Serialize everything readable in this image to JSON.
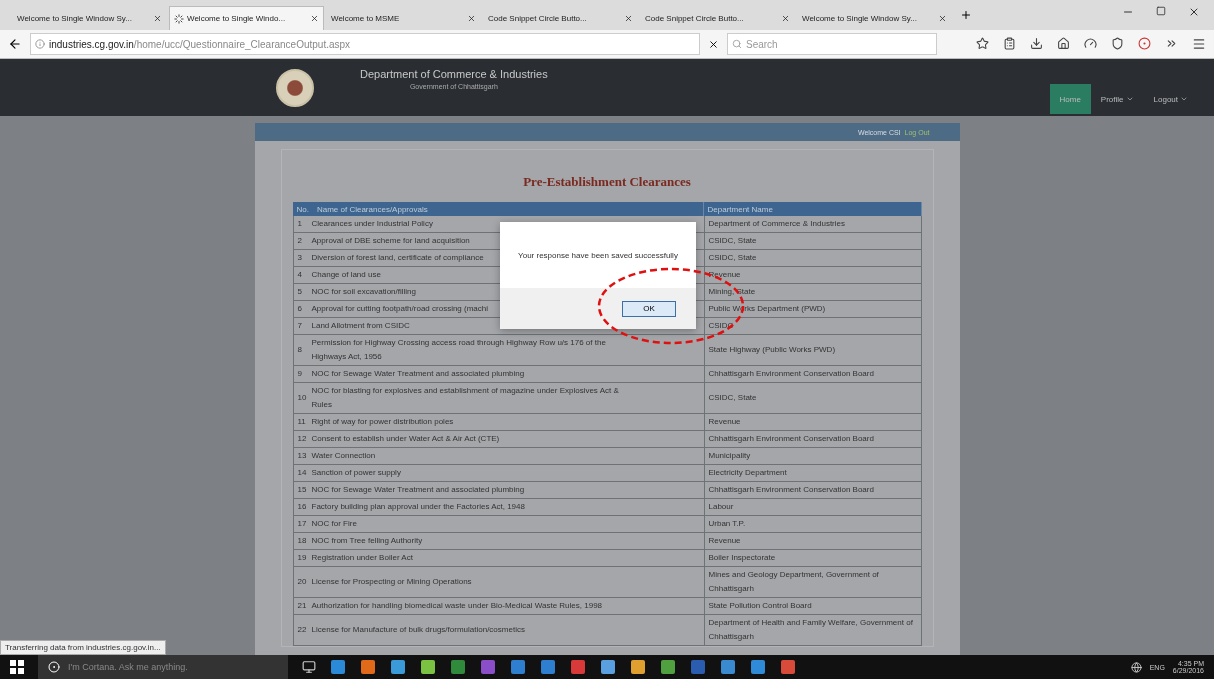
{
  "browser": {
    "tabs": [
      {
        "title": "Welcome to Single Window Sy...",
        "selected": false,
        "loading": false
      },
      {
        "title": "Welcome to Single Windo...",
        "selected": true,
        "loading": true
      },
      {
        "title": "Welcome to MSME",
        "selected": false,
        "loading": false
      },
      {
        "title": "Code Snippet Circle Butto...",
        "selected": false,
        "loading": false
      },
      {
        "title": "Code Snippet Circle Butto...",
        "selected": false,
        "loading": false
      },
      {
        "title": "Welcome to Single Window Sy...",
        "selected": false,
        "loading": false
      }
    ],
    "url_host": "industries.cg.gov.in",
    "url_path": "/home/ucc/Questionnaire_ClearanceOutput.aspx",
    "search_placeholder": "Search",
    "status_text": "Transferring data from industries.cg.gov.in..."
  },
  "header": {
    "title": "Department of Commerce & Industries",
    "subtitle": "Government of Chhattisgarh",
    "nav": [
      {
        "label": "Home",
        "selected": true,
        "dropdown": false
      },
      {
        "label": "Profile",
        "selected": false,
        "dropdown": true
      },
      {
        "label": "Logout",
        "selected": false,
        "dropdown": true
      }
    ]
  },
  "user_bar": {
    "welcome": "Welcome CSI",
    "link": "Log Out"
  },
  "page_title": "Pre-Establishment Clearances",
  "table": {
    "columns": [
      "No.",
      "Name of Clearances/Approvals",
      "Department Name"
    ],
    "rows": [
      {
        "no": "1",
        "name": "Clearances under Industrial Policy",
        "department": "Department of Commerce & Industries"
      },
      {
        "no": "2",
        "name": "Approval of DBE scheme for land acquisition",
        "department": "CSIDC, State"
      },
      {
        "no": "3",
        "name": "Diversion of forest land, certificate of compliance",
        "department": "CSIDC, State"
      },
      {
        "no": "4",
        "name": "Change of land use",
        "department": "Revenue"
      },
      {
        "no": "5",
        "name": "NOC for soil excavation/filling",
        "department": "Mining, State"
      },
      {
        "no": "6",
        "name": "Approval for cutting footpath/road crossing (machi",
        "department": "Public Works Department (PWD)"
      },
      {
        "no": "7",
        "name": "Land Allotment from CSIDC",
        "department": "CSIDC"
      },
      {
        "no": "8",
        "name": "Permission for Highway Crossing access road through Highway Row u/s 176 of the Highways Act, 1956",
        "department": "State Highway (Public Works PWD)"
      },
      {
        "no": "9",
        "name": "NOC for Sewage Water Treatment and associated plumbing",
        "department": "Chhattisgarh Environment Conservation Board"
      },
      {
        "no": "10",
        "name": "NOC for blasting for explosives and establishment of magazine under Explosives Act & Rules",
        "department": "CSIDC, State"
      },
      {
        "no": "11",
        "name": "Right of way for power distribution poles",
        "department": "Revenue"
      },
      {
        "no": "12",
        "name": "Consent to establish under Water Act & Air Act (CTE)",
        "department": "Chhattisgarh Environment Conservation Board"
      },
      {
        "no": "13",
        "name": "Water Connection",
        "department": "Municipality"
      },
      {
        "no": "14",
        "name": "Sanction of power supply",
        "department": "Electricity Department"
      },
      {
        "no": "15",
        "name": "NOC for Sewage Water Treatment and associated plumbing",
        "department": "Chhattisgarh Environment Conservation Board"
      },
      {
        "no": "16",
        "name": "Factory building plan approval under the Factories Act, 1948",
        "department": "Labour"
      },
      {
        "no": "17",
        "name": "NOC for Fire",
        "department": "Urban T.P."
      },
      {
        "no": "18",
        "name": "NOC from Tree felling Authority",
        "department": "Revenue"
      },
      {
        "no": "19",
        "name": "Registration under Boiler Act",
        "department": "Boiler Inspectorate"
      },
      {
        "no": "20",
        "name": "License for Prospecting or Mining Operations",
        "department": "Mines and Geology Department, Government of Chhattisgarh"
      },
      {
        "no": "21",
        "name": "Authorization for handling biomedical waste under Bio-Medical Waste Rules, 1998",
        "department": "State Pollution Control Board"
      },
      {
        "no": "22",
        "name": "License for Manufacture of bulk drugs/formulation/cosmetics",
        "department": "Department of Health and Family Welfare, Government of Chhattisgarh"
      }
    ]
  },
  "dialog": {
    "message": "Your response have been saved successfully",
    "button": "OK",
    "highlighted": true
  },
  "taskbar": {
    "search_placeholder": "I'm Cortana. Ask me anything.",
    "language": "ENG",
    "time": "4:35 PM",
    "date": "6/29/2016"
  }
}
